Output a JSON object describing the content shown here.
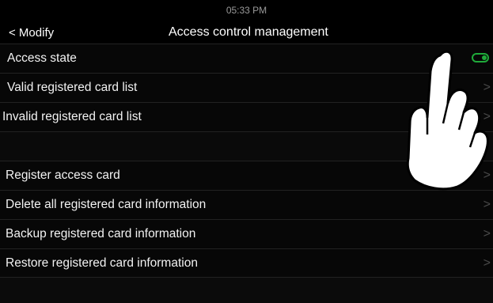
{
  "status_bar": {
    "time": "05:33 PM"
  },
  "header": {
    "back_label": "< Modify",
    "title": "Access control management"
  },
  "rows": [
    {
      "label": "Access state",
      "control": "toggle",
      "toggle_on": true
    },
    {
      "label": "Valid registered card list",
      "control": "chevron"
    },
    {
      "label": "Invalid registered card list",
      "control": "chevron"
    },
    {
      "label": "",
      "control": "none"
    },
    {
      "label": "Register access card",
      "control": "chevron"
    },
    {
      "label": "Delete all registered card information",
      "control": "chevron"
    },
    {
      "label": "Backup registered card information",
      "control": "chevron"
    },
    {
      "label": "Restore registered card information",
      "control": "chevron"
    }
  ],
  "colors": {
    "accent_green": "#1faa3a",
    "background": "#000000"
  },
  "icons": {
    "chevron": "chevron-right-icon",
    "overlay": "pointing-hand-icon"
  },
  "chevron_glyph": ">"
}
